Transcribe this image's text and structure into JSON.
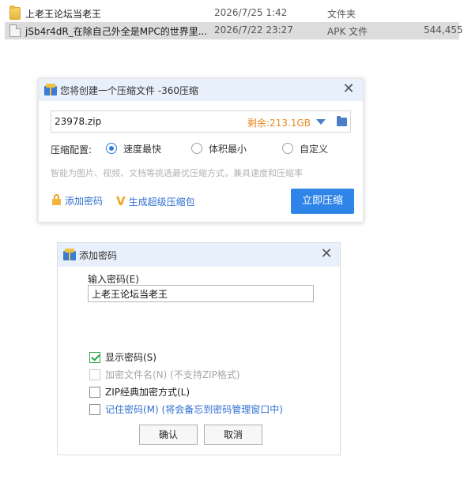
{
  "file_list": {
    "rows": [
      {
        "icon": "folder-icon",
        "name": "上老王论坛当老王",
        "date": "2026/7/25 1:42",
        "type": "文件夹",
        "size": ""
      },
      {
        "icon": "document-icon",
        "name": "jSb4r4dR_在除自己外全是MPC的世界里...",
        "date": "2026/7/22 23:27",
        "type": "APK 文件",
        "size": "544,455"
      }
    ]
  },
  "compress_dialog": {
    "title": "您将创建一个压缩文件 -360压缩",
    "filename": "23978.zip",
    "free_space": "剩余:213.1GB",
    "config_label": "压缩配置:",
    "options": [
      {
        "label": "速度最快",
        "selected": true
      },
      {
        "label": "体积最小",
        "selected": false
      },
      {
        "label": "自定义",
        "selected": false
      }
    ],
    "hint": "智能为图片、视频、文档等挑选最优压缩方式，兼具速度和压缩率",
    "add_password": "添加密码",
    "super_pack": "生成超级压缩包",
    "compress_button": "立即压缩"
  },
  "password_dialog": {
    "title": "添加密码",
    "input_label": "输入密码(E)",
    "password_value": "上老王论坛当老王",
    "checkboxes": [
      {
        "label": "显示密码(S)",
        "checked": true,
        "disabled": false
      },
      {
        "label": "加密文件名(N) (不支持ZIP格式)",
        "checked": false,
        "disabled": true
      },
      {
        "label": "ZIP经典加密方式(L)",
        "checked": false,
        "disabled": false
      },
      {
        "label": "记住密码(M) (将会备忘到密码管理窗口中)",
        "checked": false,
        "disabled": false
      }
    ],
    "ok_button": "确认",
    "cancel_button": "取消"
  },
  "colors": {
    "accent": "#2f84e8",
    "free_space": "#e8891e",
    "title_bar": "#e8f0fb",
    "check": "#2aa44a"
  }
}
